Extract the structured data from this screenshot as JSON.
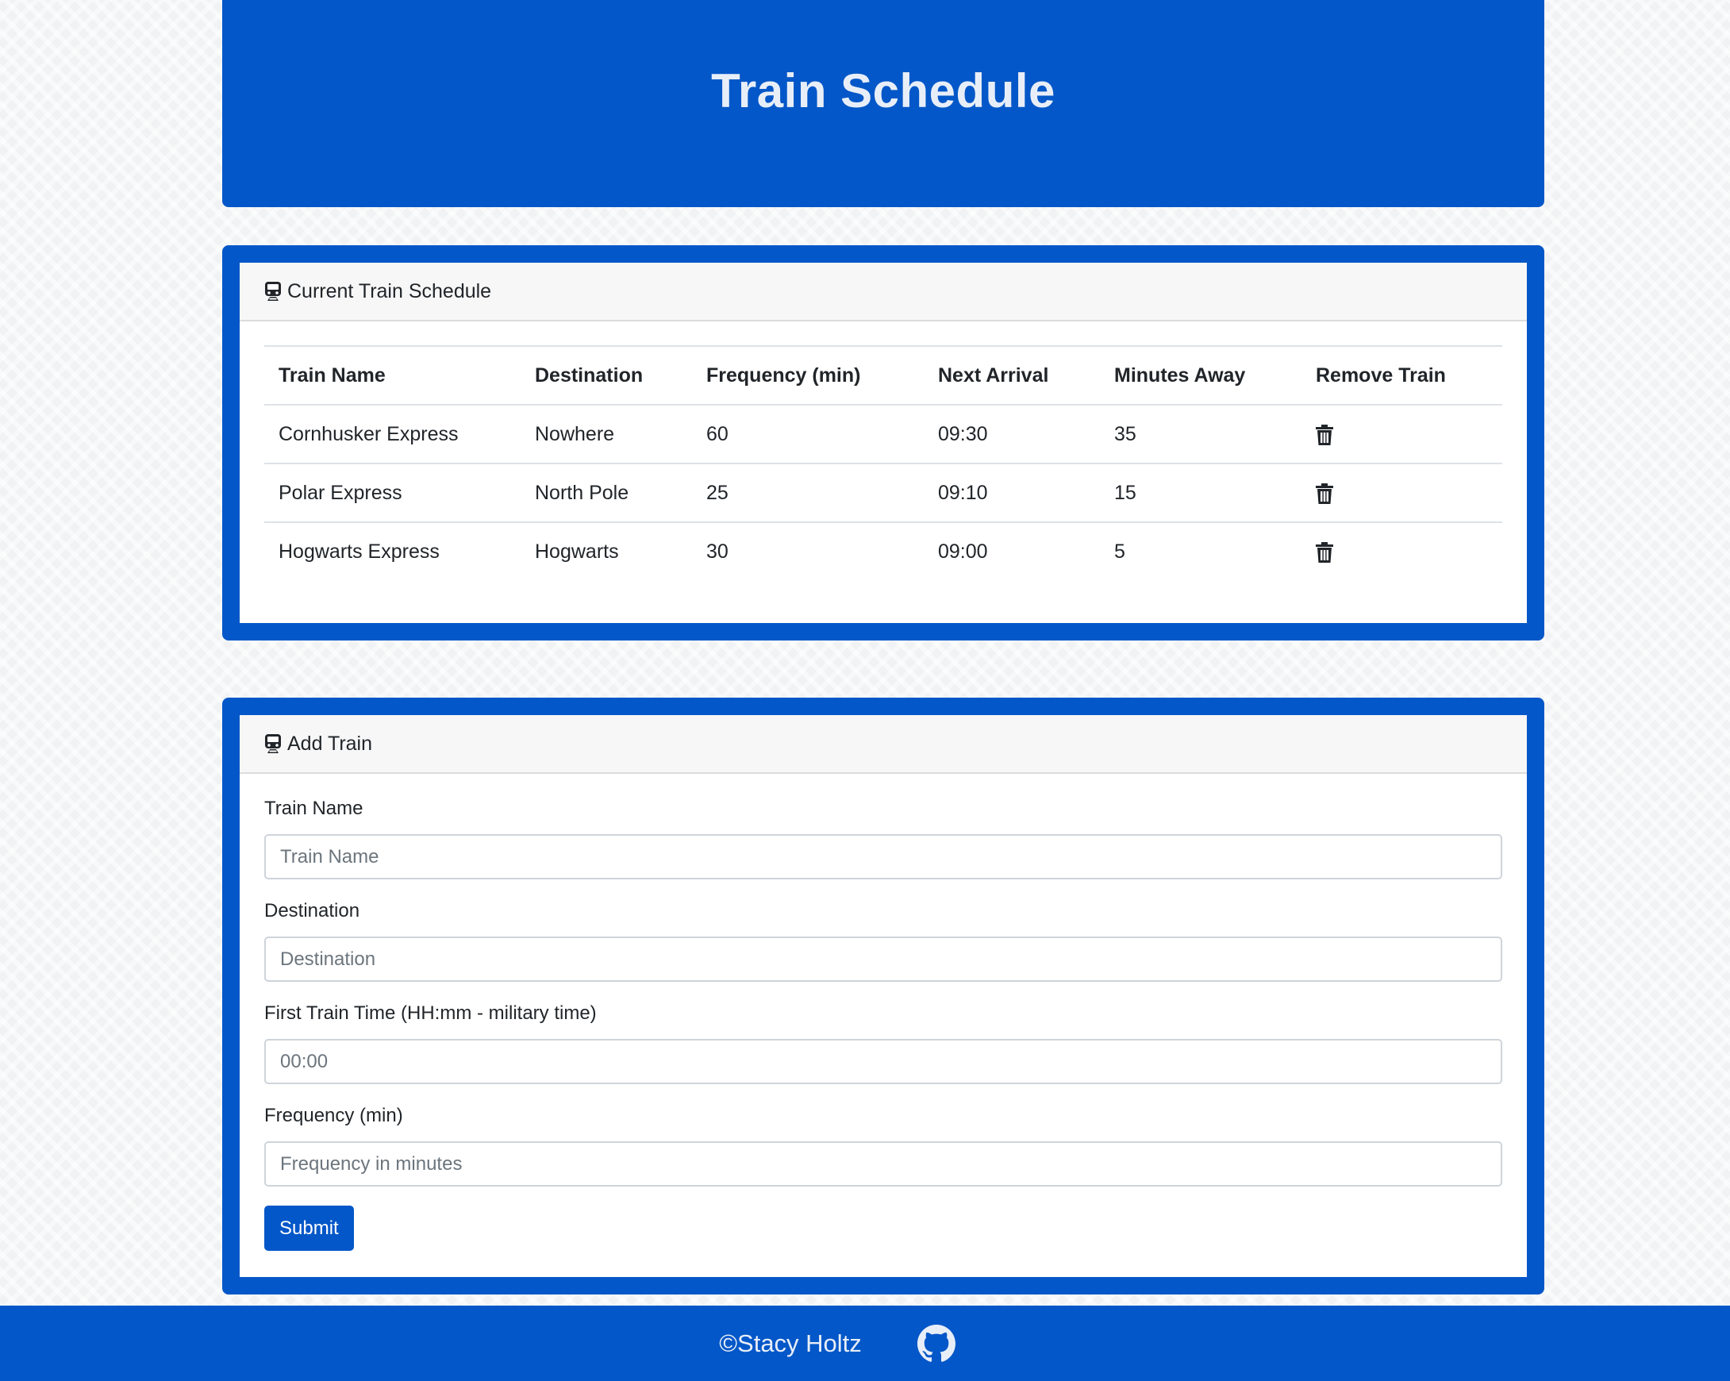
{
  "header": {
    "title": "Train Schedule"
  },
  "schedule_card": {
    "title": "Current Train Schedule",
    "columns": [
      "Train Name",
      "Destination",
      "Frequency (min)",
      "Next Arrival",
      "Minutes Away",
      "Remove Train"
    ],
    "rows": [
      {
        "name": "Cornhusker Express",
        "destination": "Nowhere",
        "frequency": "60",
        "next_arrival": "09:30",
        "minutes_away": "35"
      },
      {
        "name": "Polar Express",
        "destination": "North Pole",
        "frequency": "25",
        "next_arrival": "09:10",
        "minutes_away": "15"
      },
      {
        "name": "Hogwarts Express",
        "destination": "Hogwarts",
        "frequency": "30",
        "next_arrival": "09:00",
        "minutes_away": "5"
      }
    ]
  },
  "add_card": {
    "title": "Add Train",
    "fields": [
      {
        "label": "Train Name",
        "placeholder": "Train Name",
        "value": ""
      },
      {
        "label": "Destination",
        "placeholder": "Destination",
        "value": ""
      },
      {
        "label": "First Train Time (HH:mm - military time)",
        "placeholder": "00:00",
        "value": ""
      },
      {
        "label": "Frequency (min)",
        "placeholder": "Frequency in minutes",
        "value": ""
      }
    ],
    "submit_label": "Submit"
  },
  "footer": {
    "credit": "©Stacy Holtz",
    "icon": "github-icon"
  },
  "colors": {
    "primary": "#0357c8",
    "header_text": "#e8eef8",
    "card_header_bg": "#f7f7f7"
  }
}
